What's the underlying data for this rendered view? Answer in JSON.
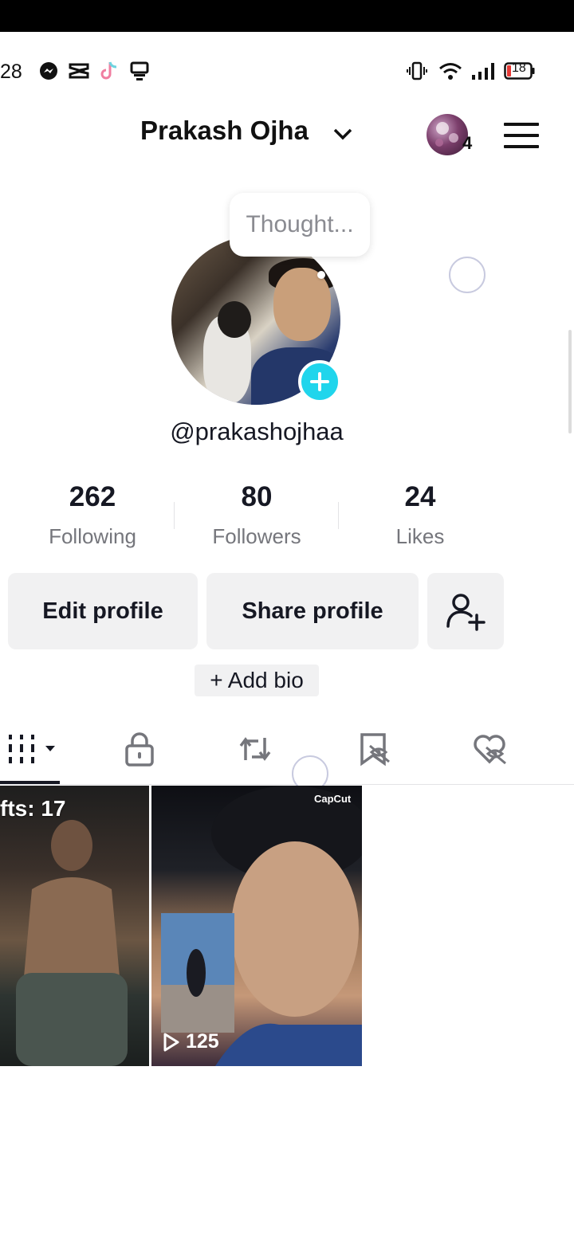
{
  "status_bar": {
    "time": "28",
    "battery": "18",
    "icons": [
      "messenger-icon",
      "capcut-icon",
      "tiktok-icon",
      "notification-icon",
      "vibrate-icon",
      "wifi-icon",
      "signal-icon",
      "battery-icon"
    ]
  },
  "header": {
    "title": "Prakash Ojha",
    "avatar_badge_count": "4",
    "icons": [
      "chevron-down-icon",
      "menu-icon"
    ]
  },
  "profile": {
    "thought_placeholder": "Thought...",
    "handle": "@prakashojhaa",
    "stats": [
      {
        "value": "262",
        "label": "Following"
      },
      {
        "value": "80",
        "label": "Followers"
      },
      {
        "value": "24",
        "label": "Likes"
      }
    ],
    "buttons": {
      "edit": "Edit profile",
      "share": "Share profile"
    },
    "add_bio": "+ Add bio"
  },
  "tabs": [
    "videos-grid-icon",
    "lock-icon",
    "repost-icon",
    "saved-icon",
    "liked-icon"
  ],
  "grid": {
    "drafts_label": "fts: 17",
    "capcut_label": "CapCut",
    "view_count": "125"
  },
  "colors": {
    "accent": "#20d5ec",
    "text": "#161823",
    "muted": "#75767c",
    "button_bg": "#f1f1f2"
  }
}
